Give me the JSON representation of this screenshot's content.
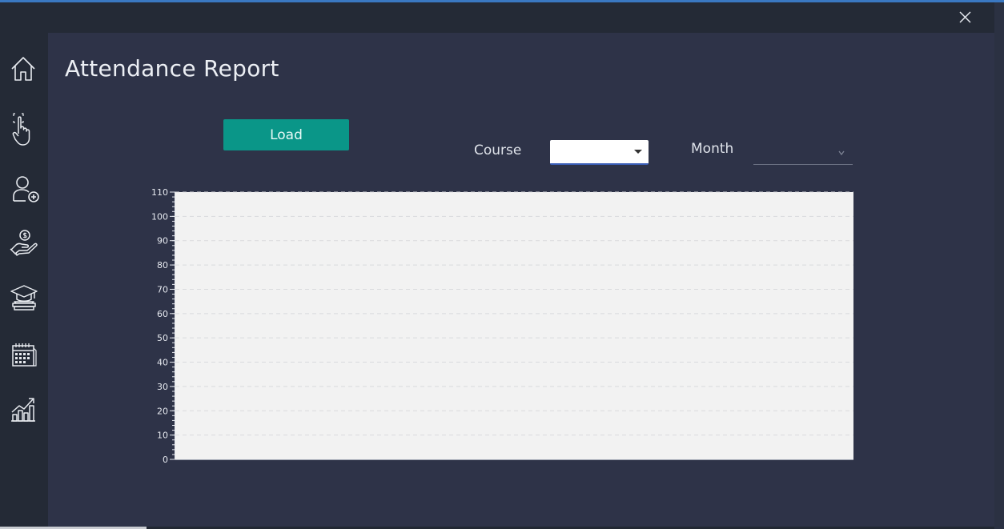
{
  "window": {
    "accent_color": "#3a78c2",
    "close_icon": "close-icon"
  },
  "sidebar": {
    "items": [
      {
        "name": "home",
        "icon": "home-icon"
      },
      {
        "name": "attendance",
        "icon": "touch-icon"
      },
      {
        "name": "add-student",
        "icon": "add-user-icon"
      },
      {
        "name": "fees",
        "icon": "money-hand-icon"
      },
      {
        "name": "courses",
        "icon": "graduation-cap-icon"
      },
      {
        "name": "calendar",
        "icon": "calendar-icon"
      },
      {
        "name": "reports",
        "icon": "chart-icon"
      }
    ]
  },
  "page": {
    "title": "Attendance Report"
  },
  "controls": {
    "load_label": "Load",
    "course_label": "Course",
    "course_value": "",
    "month_label": "Month",
    "month_value": ""
  },
  "colors": {
    "button": "#0a9688",
    "panel": "#2e3348",
    "plot_background": "#f2f2f2"
  },
  "chart_data": {
    "type": "bar",
    "title": "",
    "xlabel": "",
    "ylabel": "",
    "categories": [],
    "series": [],
    "ylim": [
      0,
      110
    ],
    "yticks": [
      "0",
      "10",
      "20",
      "30",
      "40",
      "50",
      "60",
      "70",
      "80",
      "90",
      "100",
      "110"
    ],
    "grid": true,
    "legend": "none"
  }
}
